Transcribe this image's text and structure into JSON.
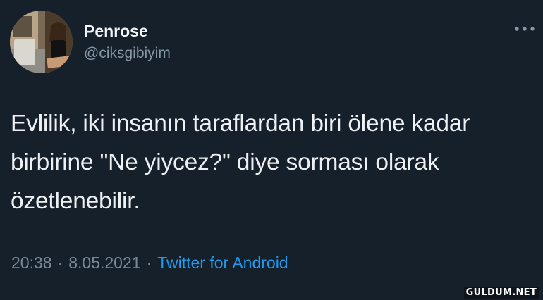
{
  "author": {
    "display_name": "Penrose",
    "handle": "@ciksgibiyim",
    "avatar_icon": "profile-photo"
  },
  "tweet": {
    "text": "Evlilik, iki insanın taraflardan biri ölene kadar\nbirbirine \"Ne yiycez?\" diye sorması olarak\nözetlenebilir.",
    "time": "20:38",
    "separator": "·",
    "date": "8.05.2021",
    "source": "Twitter for Android"
  },
  "actions": {
    "more_icon": "more-dots-icon"
  },
  "watermark": "GULDUM.NET",
  "colors": {
    "background": "#15202b",
    "text": "#eef1f3",
    "muted": "#8899a6",
    "accent": "#1d9bf0",
    "divider": "#38444d"
  }
}
